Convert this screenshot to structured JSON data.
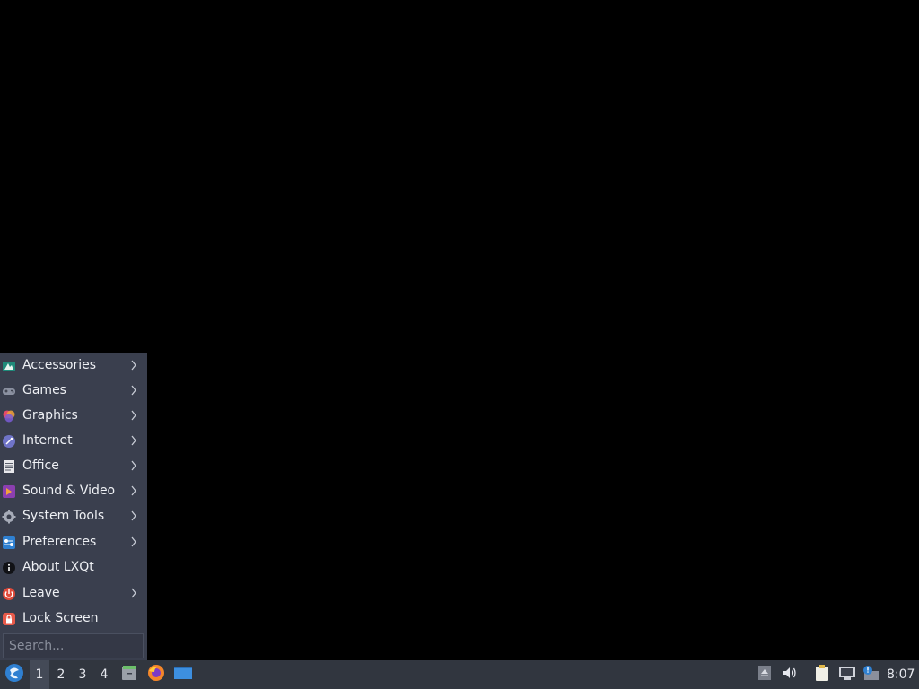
{
  "menu": {
    "items": [
      {
        "label": "Accessories",
        "icon": "accessories-icon",
        "submenu": true
      },
      {
        "label": "Games",
        "icon": "gamepad-icon",
        "submenu": true
      },
      {
        "label": "Graphics",
        "icon": "graphics-icon",
        "submenu": true
      },
      {
        "label": "Internet",
        "icon": "internet-icon",
        "submenu": true
      },
      {
        "label": "Office",
        "icon": "office-icon",
        "submenu": true
      },
      {
        "label": "Sound & Video",
        "icon": "multimedia-icon",
        "submenu": true
      },
      {
        "label": "System Tools",
        "icon": "gear-icon",
        "submenu": true
      },
      {
        "label": "Preferences",
        "icon": "preferences-icon",
        "submenu": true
      },
      {
        "label": "About LXQt",
        "icon": "info-icon",
        "submenu": false
      },
      {
        "label": "Leave",
        "icon": "power-icon",
        "submenu": true
      },
      {
        "label": "Lock Screen",
        "icon": "lock-icon",
        "submenu": false
      }
    ],
    "search_placeholder": "Search..."
  },
  "taskbar": {
    "workspaces": [
      "1",
      "2",
      "3",
      "4"
    ],
    "active_workspace": "1",
    "quicklaunch": [
      "file-manager-icon",
      "firefox-icon",
      "show-desktop-icon"
    ],
    "tray": [
      "eject-icon",
      "volume-icon",
      "clipboard-icon",
      "network-icon",
      "notification-icon"
    ],
    "clock": "8:07"
  },
  "colors": {
    "desktop": "#000000",
    "menu_bg": "#3a3f4e",
    "taskbar_bg": "#31363f",
    "accent": "#2f80d1"
  }
}
